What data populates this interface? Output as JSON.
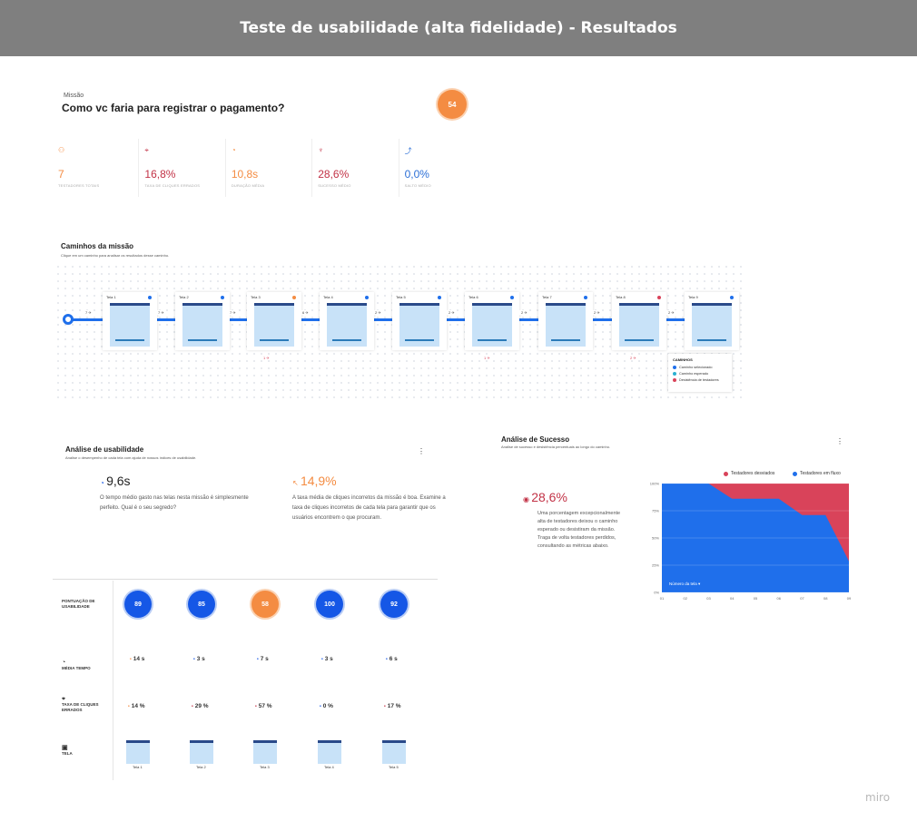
{
  "header": {
    "title": "Teste de usabilidade (alta fidelidade) - Resultados"
  },
  "mission": {
    "label": "Missão",
    "question": "Como vc faria para registrar o pagamento?",
    "score": "54",
    "metrics": [
      {
        "icon": "users-icon",
        "value": "7",
        "label": "TESTADORES TOTAIS",
        "color": "#f48c42"
      },
      {
        "icon": "mouse-click-icon",
        "value": "16,8%",
        "label": "TAXA DE CLIQUES ERRADOS",
        "color": "#c23246"
      },
      {
        "icon": "clock-icon",
        "value": "10,8s",
        "label": "DURAÇÃO MÉDIA",
        "color": "#f48c42"
      },
      {
        "icon": "trophy-icon",
        "value": "28,6%",
        "label": "SUCESSO MÉDIO",
        "color": "#c23246"
      },
      {
        "icon": "jump-arrow-icon",
        "value": "0,0%",
        "label": "SALTO MÉDIO",
        "color": "#2b6fd6"
      }
    ]
  },
  "paths": {
    "title": "Caminhos da missão",
    "subtitle": "Clique em um caminho para analisar os resultados desse caminho.",
    "screens": [
      {
        "name": "Tela 1",
        "dot": "blue"
      },
      {
        "name": "Tela 2",
        "dot": "blue"
      },
      {
        "name": "Tela 3",
        "dot": "orange"
      },
      {
        "name": "Tela 4",
        "dot": "blue"
      },
      {
        "name": "Tela 5",
        "dot": "blue"
      },
      {
        "name": "Tela 6",
        "dot": "blue"
      },
      {
        "name": "Tela 7",
        "dot": "blue"
      },
      {
        "name": "Tela 8",
        "dot": "red"
      },
      {
        "name": "Tela 9",
        "dot": "blue"
      }
    ],
    "connectors": [
      "7 ✈",
      "7 ✈",
      "7 ✈",
      "6 ✈",
      "2 ✈",
      "2 ✈",
      "2 ✈",
      "2 ✈",
      "2 ✈"
    ],
    "drops": [
      "1 ✈",
      "1 ✈",
      "2 ✈"
    ],
    "legend": {
      "title": "CAMINHOS",
      "items": [
        {
          "label": "Caminho selecionado",
          "color": "#1f6feb"
        },
        {
          "label": "Caminho esperado",
          "color": "#2bb0d0"
        },
        {
          "label": "Desistência de testadores",
          "color": "#d9435a"
        }
      ]
    }
  },
  "usability": {
    "title": "Análise de usabilidade",
    "subtitle": "Analise o desempenho de cada tela com ajuda de nossos índices de usabilidade.",
    "time_value": "9,6s",
    "time_text": "O tempo médio gasto nas telas nesta missão é simplesmente perfeito. Qual é o seu segredo?",
    "misclick_value": "14,9%",
    "misclick_text": "A taxa média de cliques incorretos da missão é boa. Examine a taxa de cliques incorretos de cada tela para garantir que os usuários encontrem o que procuram.",
    "row_labels": {
      "score": "PONTUAÇÃO DE USABILIDADE",
      "time": "MÉDIA TEMPO",
      "misclick": "TAXA DE CLIQUES ERRADOS",
      "screen": "TELA"
    },
    "scores": [
      "89",
      "85",
      "58",
      "100",
      "92"
    ],
    "times": [
      "14 s",
      "3 s",
      "7 s",
      "3 s",
      "6 s"
    ],
    "misclicks": [
      "14 %",
      "29 %",
      "57 %",
      "0 %",
      "17 %"
    ],
    "screens": [
      "Tela 1",
      "Tela 2",
      "Tela 3",
      "Tela 4",
      "Tela 5"
    ]
  },
  "success": {
    "title": "Análise de Sucesso",
    "subtitle": "Análise de sucesso e desistência percentuais ao longo do caminho.",
    "value": "28,6%",
    "text": "Uma porcentagem excepcionalmente alta de testadores deixou o caminho esperado ou desistiram da missão. Traga de volta testadores perdidos, consultando as métricas abaixo.",
    "xlabel_overlay": "Número da tela ▾"
  },
  "chart_data": {
    "type": "area",
    "x": [
      "01",
      "02",
      "03",
      "04",
      "05",
      "06",
      "07",
      "08",
      "09"
    ],
    "series": [
      {
        "name": "Testadores em fluxo",
        "color": "#1f6feb",
        "values": [
          100,
          100,
          100,
          86,
          86,
          86,
          71,
          71,
          28.6
        ]
      },
      {
        "name": "Testadores desviados",
        "color": "#d9435a",
        "values": [
          0,
          0,
          0,
          14,
          14,
          14,
          29,
          29,
          71.4
        ]
      }
    ],
    "y_ticks": [
      "100%",
      "75%",
      "50%",
      "25%",
      "0%"
    ],
    "ylim": [
      0,
      100
    ],
    "legend": "top-right"
  },
  "brand": "miro"
}
